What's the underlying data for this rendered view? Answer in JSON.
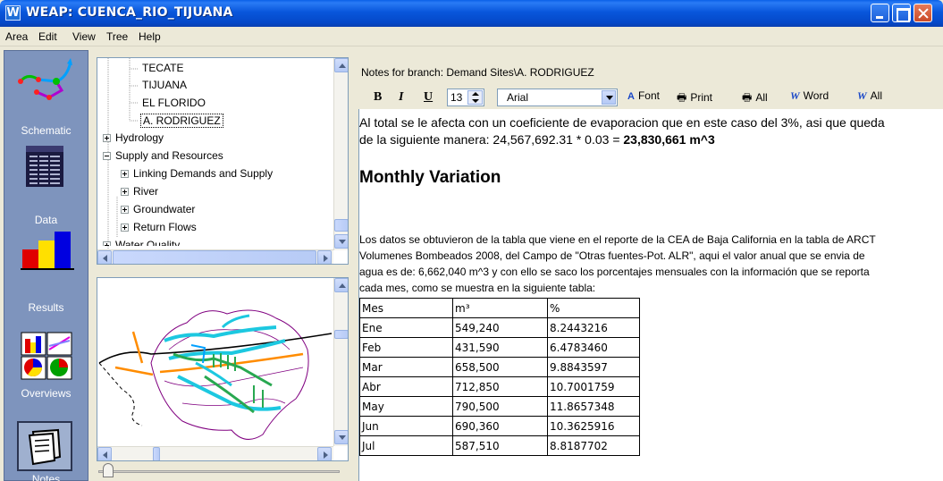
{
  "window": {
    "title": "WEAP: CUENCA_RIO_TIJUANA",
    "icon_letter": "W"
  },
  "menu": [
    "Area",
    "Edit",
    "View",
    "Tree",
    "Help"
  ],
  "views": [
    {
      "label": "Schematic"
    },
    {
      "label": "Data"
    },
    {
      "label": "Results"
    },
    {
      "label": "Overviews"
    },
    {
      "label": "Notes"
    }
  ],
  "tree": {
    "items": [
      {
        "label": "TECATE"
      },
      {
        "label": "TIJUANA"
      },
      {
        "label": "EL FLORIDO"
      },
      {
        "label": "A. RODRIGUEZ"
      },
      {
        "label": "Hydrology"
      },
      {
        "label": "Supply and Resources"
      },
      {
        "label": "Linking Demands and Supply"
      },
      {
        "label": "River"
      },
      {
        "label": "Groundwater"
      },
      {
        "label": "Return Flows"
      },
      {
        "label": "Water Quality"
      }
    ]
  },
  "notes": {
    "branch_title": "Notes for branch: Demand Sites\\A. RODRIGUEZ",
    "toolbar": {
      "bold": "B",
      "italic": "I",
      "underline": "U",
      "font_size": "13",
      "font_name": "Arial",
      "font_btn": "Font",
      "print_btn": "Print",
      "all_btn": "All",
      "word_btn": "Word",
      "word_all_btn": "All"
    },
    "para1_line1": "Al total se le afecta con un coeficiente de evaporacion que en este caso del 3%, asi que queda",
    "para1_line2_prefix": "de la siguiente manera: 24,567,692.31 * 0.03 = ",
    "para1_line2_bold": "23,830,661 m^3",
    "heading": "Monthly Variation",
    "para2": [
      "Los datos se obtuvieron de la tabla que viene en el reporte de la CEA de Baja California en la tabla de ARCT",
      "Volumenes Bombeados 2008, del Campo de \"Otras fuentes-Pot. ALR\", aqui el valor anual que se envia de",
      "agua es de: 6,662,040 m^3 y con ello se saco los porcentajes mensuales con la información que se reporta",
      "cada mes, como se muestra en la siguiente tabla:"
    ],
    "table": {
      "headers": [
        "Mes",
        "m³",
        "%"
      ],
      "rows": [
        [
          "Ene",
          "549,240",
          "8.2443216"
        ],
        [
          "Feb",
          "431,590",
          "6.4783460"
        ],
        [
          "Mar",
          "658,500",
          "9.8843597"
        ],
        [
          "Abr",
          "712,850",
          "10.7001759"
        ],
        [
          "May",
          "790,500",
          "11.8657348"
        ],
        [
          "Jun",
          "690,360",
          "10.3625916"
        ],
        [
          "Jul",
          "587,510",
          "8.8187702"
        ]
      ]
    }
  }
}
